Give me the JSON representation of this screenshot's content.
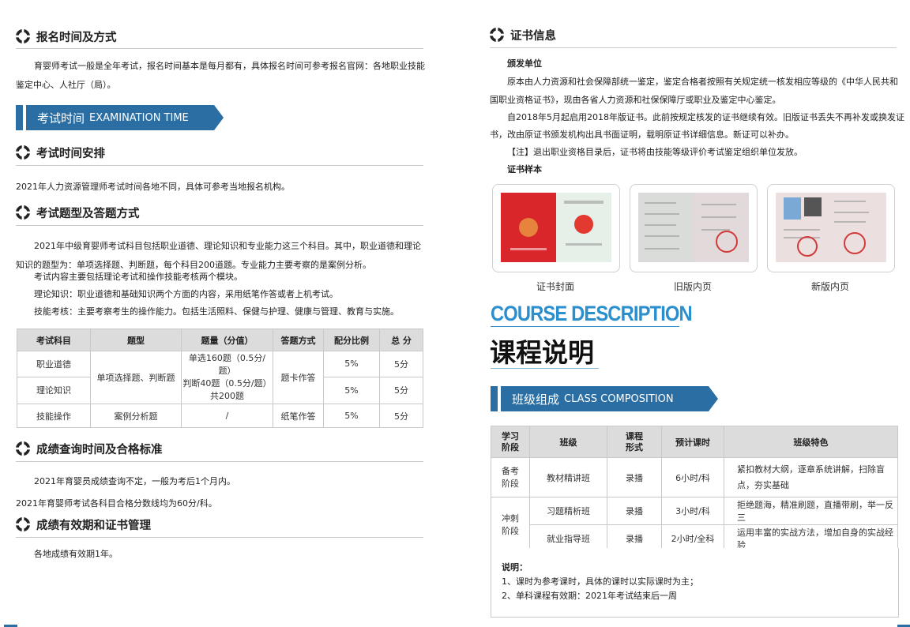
{
  "left": {
    "reg": {
      "title": "报名时间及方式",
      "line1": "育婴师考试一般是全年考试，报名时间基本是每月都有，具体报名时间可参考报名官网：各地职业技能",
      "line2": "鉴定中心、人社厅（局）。"
    },
    "exam_banner": {
      "cn": "考试时间",
      "en": "EXAMINATION TIME"
    },
    "schedule": {
      "title": "考试时间安排",
      "line1": "2021年人力资源管理师考试时间各地不同，具体可参考当地报名机构。"
    },
    "format": {
      "title": "考试题型及答题方式",
      "line1": "2021年中级育婴师考试科目包括职业道德、理论知识和专业能力这三个科目。其中，职业道德和理论",
      "line2": "知识的题型为：单项选择题、判断题，每个科目200道题。专业能力主要考察的是案例分析。",
      "line3": "考试内容主要包括理论考试和操作技能考核两个模块。",
      "line4": "理论知识：职业道德和基础知识两个方面的内容，采用纸笔作答或者上机考试。",
      "line5": "技能考核：主要考察考生的操作能力。包括生活照料、保健与护理、健康与管理、教育与实施。"
    },
    "exam_table": {
      "headers": [
        "考试科目",
        "题型",
        "题量（分值）",
        "答题方式",
        "配分比例",
        "总 分"
      ],
      "rows": [
        {
          "subject": "职业道德",
          "ratio": "5%",
          "total": "5分"
        },
        {
          "subject": "理论知识",
          "ratio": "5%",
          "total": "5分"
        },
        {
          "subject": "技能操作",
          "type": "案例分析题",
          "qty": "/",
          "method": "纸笔作答",
          "ratio": "5%",
          "total": "5分"
        }
      ],
      "merged_type": "单项选择题、判断题",
      "merged_qty_1": "单选160题（0.5分/题）",
      "merged_qty_2": "判断40题（0.5分/题）",
      "merged_qty_3": "共200题",
      "merged_method": "题卡作答"
    },
    "results": {
      "title": "成绩查询时间及合格标准",
      "line1": "2021年育婴员成绩查询不定，一般为考后1个月内。",
      "line2": "2021年育婴师考试各科目合格分数线均为60分/科。"
    },
    "validity": {
      "title": "成绩有效期和证书管理",
      "line1": "各地成绩有效期1年。"
    }
  },
  "right": {
    "cert": {
      "title": "证书信息",
      "issuer_label": "颁发单位",
      "line1": "原本由人力资源和社会保障部统一鉴定，鉴定合格者按照有关规定统一核发相应等级的《中华人民共和",
      "line2": "国职业资格证书》，现由各省人力资源和社保保障厅或职业及鉴定中心鉴定。",
      "line3": "自2018年5月起启用2018年版证书。此前按规定核发的证书继续有效。旧版证书丢失不再补发或换发证",
      "line4": "书，改由原证书颁发机构出具书面证明，载明原证书详细信息。新证可以补办。",
      "line5": "【注】退出职业资格目录后，证书将由技能等级评价考试鉴定组织单位发放。",
      "sample_label": "证书样本",
      "samples": [
        {
          "caption": "证书封面"
        },
        {
          "caption": "旧版内页"
        },
        {
          "caption": "新版内页"
        }
      ]
    },
    "course": {
      "en_title": "COURSE DESCRIPTION",
      "cn_title": "课程说明"
    },
    "class_banner": {
      "cn": "班级组成",
      "en": "CLASS COMPOSITION"
    },
    "class_table": {
      "headers": [
        "学习\n阶段",
        "班级",
        "课程\n形式",
        "预计课时",
        "班级特色"
      ],
      "stage_1": "备考\n阶段",
      "stage_2": "冲刺\n阶段",
      "rows": [
        {
          "class": "教材精讲班",
          "form": "录播",
          "hours": "6小时/科",
          "feature": "紧扣教材大纲，逐章系统讲解，扫除盲点，夯实基础"
        },
        {
          "class": "习题精析班",
          "form": "录播",
          "hours": "3小时/科",
          "feature": "拒绝题海，精准刷题，直播带刷，举一反三"
        },
        {
          "class": "就业指导班",
          "form": "录播",
          "hours": "2小时/全科",
          "feature": "运用丰富的实战方法，增加自身的实战经验"
        }
      ]
    },
    "notes": {
      "title": "说明：",
      "line1": "1、课时为参考课时，具体的课时以实际课时为主；",
      "line2": "2、单科课程有效期：2021年考试结束后一周"
    }
  },
  "colors": {
    "accent": "#2a6ea3",
    "course_title": "#2a8fcc",
    "header_bg": "#dcdcdc"
  }
}
